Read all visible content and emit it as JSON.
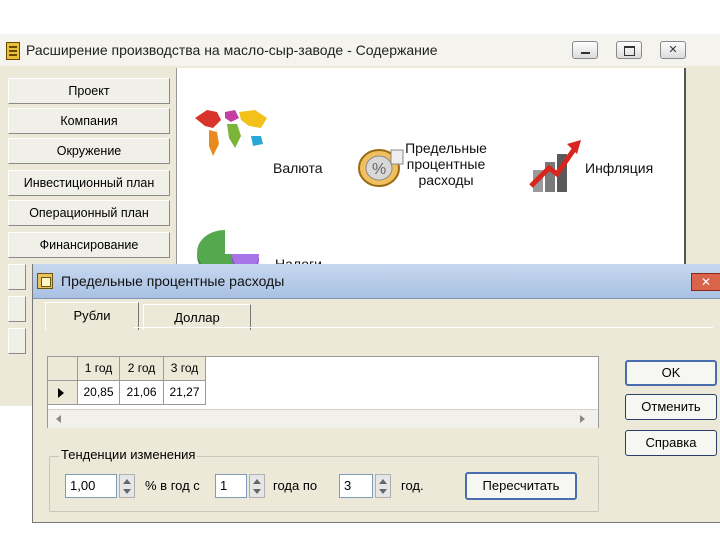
{
  "main_window": {
    "title": "Расширение производства на масло-сыр-заводе - Содержание",
    "nav_items": [
      {
        "label": "Проект"
      },
      {
        "label": "Компания"
      },
      {
        "label": "Окружение"
      },
      {
        "label": "Инвестиционный план"
      },
      {
        "label": "Операционный план"
      },
      {
        "label": "Финансирование"
      }
    ],
    "tiles": {
      "currency": {
        "label": "Валюта",
        "icon": "world-map-icon"
      },
      "interest": {
        "line1": "Предельные",
        "line2": "процентные",
        "line3": "расходы",
        "icon": "coin-percent-icon"
      },
      "inflation": {
        "label": "Инфляция",
        "icon": "inflation-chart-icon"
      },
      "taxes": {
        "label": "Налоги",
        "icon": "tax-pie-icon"
      }
    }
  },
  "dialog": {
    "title": "Предельные процентные расходы",
    "tabs": [
      {
        "label": "Рубли",
        "active": true
      },
      {
        "label": "Доллар",
        "active": false
      }
    ],
    "grid": {
      "headers": [
        "1 год",
        "2 год",
        "3 год"
      ],
      "rows": [
        [
          "20,85",
          "21,06",
          "21,27"
        ]
      ]
    },
    "buttons": {
      "ok": "OK",
      "cancel": "Отменить",
      "help": "Справка"
    },
    "trend": {
      "legend": "Тенденции изменения",
      "rate_value": "1,00",
      "rate_unit": "% в год  с",
      "from_value": "1",
      "from_unit": "года  по",
      "to_value": "3",
      "to_unit": "год.",
      "recalc_label": "Пересчитать"
    }
  },
  "colors": {
    "window_bg": "#ece9d8",
    "dialog_title": "#b8cce9",
    "close_button": "#d9644a",
    "default_button_border": "#4a6db0"
  }
}
